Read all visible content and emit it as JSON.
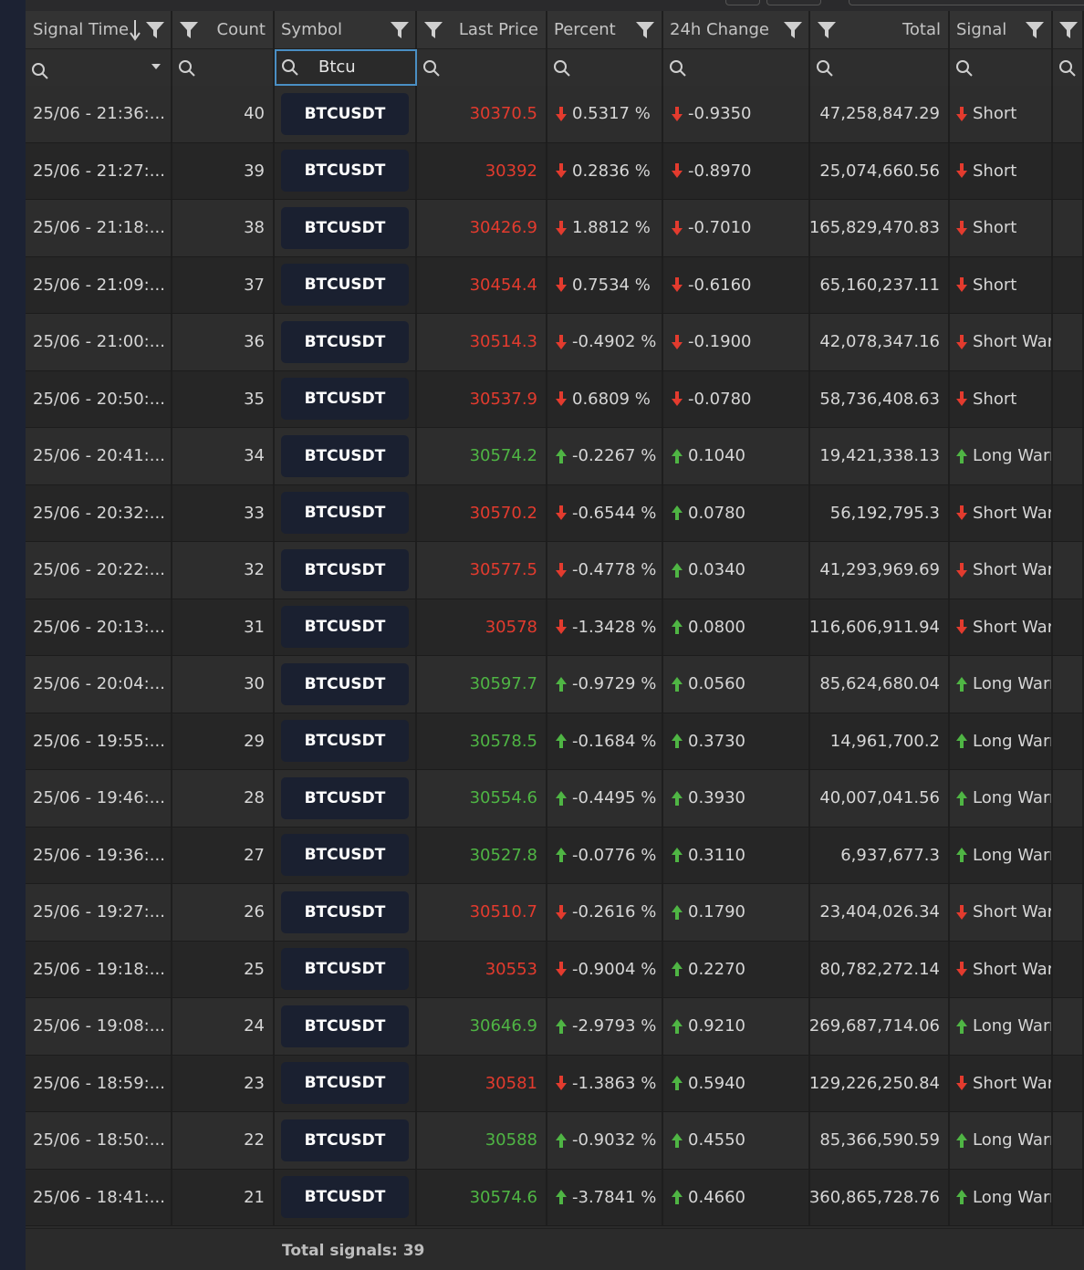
{
  "columns": [
    {
      "key": "time",
      "label": "Signal Time"
    },
    {
      "key": "count",
      "label": "Count"
    },
    {
      "key": "symbol",
      "label": "Symbol"
    },
    {
      "key": "price",
      "label": "Last Price"
    },
    {
      "key": "percent",
      "label": "Percent"
    },
    {
      "key": "change",
      "label": "24h Change"
    },
    {
      "key": "total",
      "label": "Total"
    },
    {
      "key": "signal",
      "label": "Signal"
    }
  ],
  "filters": {
    "symbol_value": "Btcu"
  },
  "colors": {
    "up": "#4fb544",
    "down": "#e33b2e",
    "header": "#333333",
    "symbol_button": "#1a2030"
  },
  "rows": [
    {
      "time": "25/06 - 21:36:...",
      "count": "40",
      "symbol": "BTCUSDT",
      "price": "30370.5",
      "price_dir": "down",
      "percent": "0.5317 %",
      "percent_dir": "down",
      "change": "-0.9350",
      "change_dir": "down",
      "total": "47,258,847.29",
      "signal": "Short",
      "signal_dir": "down"
    },
    {
      "time": "25/06 - 21:27:...",
      "count": "39",
      "symbol": "BTCUSDT",
      "price": "30392",
      "price_dir": "down",
      "percent": "0.2836 %",
      "percent_dir": "down",
      "change": "-0.8970",
      "change_dir": "down",
      "total": "25,074,660.56",
      "signal": "Short",
      "signal_dir": "down"
    },
    {
      "time": "25/06 - 21:18:...",
      "count": "38",
      "symbol": "BTCUSDT",
      "price": "30426.9",
      "price_dir": "down",
      "percent": "1.8812 %",
      "percent_dir": "down",
      "change": "-0.7010",
      "change_dir": "down",
      "total": "165,829,470.83",
      "signal": "Short",
      "signal_dir": "down"
    },
    {
      "time": "25/06 - 21:09:...",
      "count": "37",
      "symbol": "BTCUSDT",
      "price": "30454.4",
      "price_dir": "down",
      "percent": "0.7534 %",
      "percent_dir": "down",
      "change": "-0.6160",
      "change_dir": "down",
      "total": "65,160,237.11",
      "signal": "Short",
      "signal_dir": "down"
    },
    {
      "time": "25/06 - 21:00:...",
      "count": "36",
      "symbol": "BTCUSDT",
      "price": "30514.3",
      "price_dir": "down",
      "percent": "-0.4902 %",
      "percent_dir": "down",
      "change": "-0.1900",
      "change_dir": "down",
      "total": "42,078,347.16",
      "signal": "Short Warı",
      "signal_dir": "down"
    },
    {
      "time": "25/06 - 20:50:...",
      "count": "35",
      "symbol": "BTCUSDT",
      "price": "30537.9",
      "price_dir": "down",
      "percent": "0.6809 %",
      "percent_dir": "down",
      "change": "-0.0780",
      "change_dir": "down",
      "total": "58,736,408.63",
      "signal": "Short",
      "signal_dir": "down"
    },
    {
      "time": "25/06 - 20:41:...",
      "count": "34",
      "symbol": "BTCUSDT",
      "price": "30574.2",
      "price_dir": "up",
      "percent": "-0.2267 %",
      "percent_dir": "up",
      "change": "0.1040",
      "change_dir": "up",
      "total": "19,421,338.13",
      "signal": "Long Warn",
      "signal_dir": "up"
    },
    {
      "time": "25/06 - 20:32:...",
      "count": "33",
      "symbol": "BTCUSDT",
      "price": "30570.2",
      "price_dir": "down",
      "percent": "-0.6544 %",
      "percent_dir": "down",
      "change": "0.0780",
      "change_dir": "up",
      "total": "56,192,795.3",
      "signal": "Short Warı",
      "signal_dir": "down"
    },
    {
      "time": "25/06 - 20:22:...",
      "count": "32",
      "symbol": "BTCUSDT",
      "price": "30577.5",
      "price_dir": "down",
      "percent": "-0.4778 %",
      "percent_dir": "down",
      "change": "0.0340",
      "change_dir": "up",
      "total": "41,293,969.69",
      "signal": "Short Warı",
      "signal_dir": "down"
    },
    {
      "time": "25/06 - 20:13:...",
      "count": "31",
      "symbol": "BTCUSDT",
      "price": "30578",
      "price_dir": "down",
      "percent": "-1.3428 %",
      "percent_dir": "down",
      "change": "0.0800",
      "change_dir": "up",
      "total": "116,606,911.94",
      "signal": "Short Warı",
      "signal_dir": "down"
    },
    {
      "time": "25/06 - 20:04:...",
      "count": "30",
      "symbol": "BTCUSDT",
      "price": "30597.7",
      "price_dir": "up",
      "percent": "-0.9729 %",
      "percent_dir": "up",
      "change": "0.0560",
      "change_dir": "up",
      "total": "85,624,680.04",
      "signal": "Long Warn",
      "signal_dir": "up"
    },
    {
      "time": "25/06 - 19:55:...",
      "count": "29",
      "symbol": "BTCUSDT",
      "price": "30578.5",
      "price_dir": "up",
      "percent": "-0.1684 %",
      "percent_dir": "up",
      "change": "0.3730",
      "change_dir": "up",
      "total": "14,961,700.2",
      "signal": "Long Warn",
      "signal_dir": "up"
    },
    {
      "time": "25/06 - 19:46:...",
      "count": "28",
      "symbol": "BTCUSDT",
      "price": "30554.6",
      "price_dir": "up",
      "percent": "-0.4495 %",
      "percent_dir": "up",
      "change": "0.3930",
      "change_dir": "up",
      "total": "40,007,041.56",
      "signal": "Long Warn",
      "signal_dir": "up"
    },
    {
      "time": "25/06 - 19:36:...",
      "count": "27",
      "symbol": "BTCUSDT",
      "price": "30527.8",
      "price_dir": "up",
      "percent": "-0.0776 %",
      "percent_dir": "up",
      "change": "0.3110",
      "change_dir": "up",
      "total": "6,937,677.3",
      "signal": "Long Warn",
      "signal_dir": "up"
    },
    {
      "time": "25/06 - 19:27:...",
      "count": "26",
      "symbol": "BTCUSDT",
      "price": "30510.7",
      "price_dir": "down",
      "percent": "-0.2616 %",
      "percent_dir": "down",
      "change": "0.1790",
      "change_dir": "up",
      "total": "23,404,026.34",
      "signal": "Short Warı",
      "signal_dir": "down"
    },
    {
      "time": "25/06 - 19:18:...",
      "count": "25",
      "symbol": "BTCUSDT",
      "price": "30553",
      "price_dir": "down",
      "percent": "-0.9004 %",
      "percent_dir": "down",
      "change": "0.2270",
      "change_dir": "up",
      "total": "80,782,272.14",
      "signal": "Short Warı",
      "signal_dir": "down"
    },
    {
      "time": "25/06 - 19:08:...",
      "count": "24",
      "symbol": "BTCUSDT",
      "price": "30646.9",
      "price_dir": "up",
      "percent": "-2.9793 %",
      "percent_dir": "up",
      "change": "0.9210",
      "change_dir": "up",
      "total": "269,687,714.06",
      "signal": "Long Warn",
      "signal_dir": "up"
    },
    {
      "time": "25/06 - 18:59:...",
      "count": "23",
      "symbol": "BTCUSDT",
      "price": "30581",
      "price_dir": "down",
      "percent": "-1.3863 %",
      "percent_dir": "down",
      "change": "0.5940",
      "change_dir": "up",
      "total": "129,226,250.84",
      "signal": "Short Warı",
      "signal_dir": "down"
    },
    {
      "time": "25/06 - 18:50:...",
      "count": "22",
      "symbol": "BTCUSDT",
      "price": "30588",
      "price_dir": "up",
      "percent": "-0.9032 %",
      "percent_dir": "up",
      "change": "0.4550",
      "change_dir": "up",
      "total": "85,366,590.59",
      "signal": "Long Warn",
      "signal_dir": "up"
    },
    {
      "time": "25/06 - 18:41:...",
      "count": "21",
      "symbol": "BTCUSDT",
      "price": "30574.6",
      "price_dir": "up",
      "percent": "-3.7841 %",
      "percent_dir": "up",
      "change": "0.4660",
      "change_dir": "up",
      "total": "360,865,728.76",
      "signal": "Long Warn",
      "signal_dir": "up"
    }
  ],
  "footer": {
    "total_label": "Total signals: 39"
  }
}
